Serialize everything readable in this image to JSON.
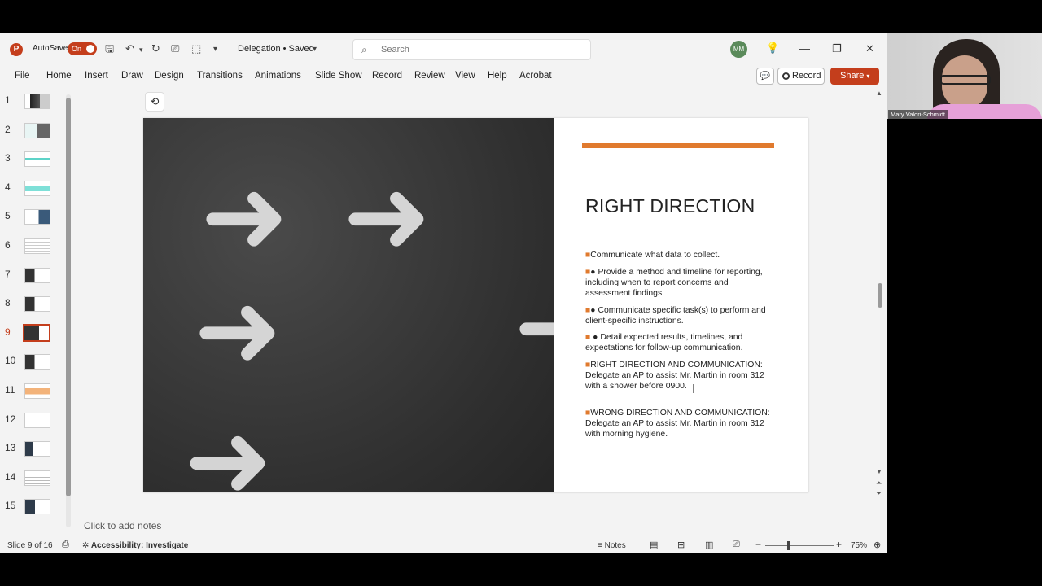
{
  "titlebar": {
    "app_logo": "P",
    "autosave_label": "AutoSave",
    "autosave_state": "On",
    "doc_title": "Delegation • Saved",
    "search_placeholder": "Search",
    "avatar_initials": "MM"
  },
  "menu": {
    "tabs": [
      "File",
      "Home",
      "Insert",
      "Draw",
      "Design",
      "Transitions",
      "Animations",
      "Slide Show",
      "Record",
      "Review",
      "View",
      "Help",
      "Acrobat"
    ],
    "record_label": "Record",
    "share_label": "Share"
  },
  "thumbnails": {
    "numbers": [
      "1",
      "2",
      "3",
      "4",
      "5",
      "6",
      "7",
      "8",
      "9",
      "10",
      "11",
      "12",
      "13",
      "14",
      "15"
    ],
    "selected": "9"
  },
  "slide": {
    "title": "RIGHT DIRECTION",
    "bullets": [
      "Communicate what data to collect.",
      "● Provide a method and timeline for reporting, including when to report concerns and assessment findings.",
      "● Communicate specific task(s) to perform and client-specific instructions.",
      " ● Detail expected results, timelines, and expectations for follow-up communication.",
      "RIGHT DIRECTION AND COMMUNICATION: Delegate an AP to assist Mr. Martin in room 312 with a shower before 0900.",
      "WRONG DIRECTION AND COMMUNICATION: Delegate an AP to assist Mr. Martin in room 312 with morning hygiene."
    ],
    "bullet_marker": "■",
    "accent_color": "#e07a2e"
  },
  "notes_placeholder": "Click to add notes",
  "status": {
    "slide_counter": "Slide 9 of 16",
    "accessibility": "Accessibility: Investigate",
    "notes_label": "Notes",
    "zoom": "75%"
  },
  "webcam": {
    "participant_name": "Mary Valori-Schmidt"
  }
}
